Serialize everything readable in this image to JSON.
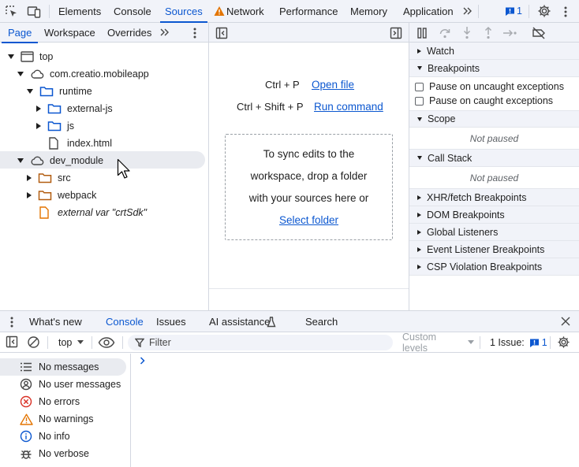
{
  "top_tabs": [
    {
      "label": "Elements"
    },
    {
      "label": "Console"
    },
    {
      "label": "Sources"
    },
    {
      "label": "Network"
    },
    {
      "label": "Performance"
    },
    {
      "label": "Memory"
    },
    {
      "label": "Application"
    }
  ],
  "issues_badge": "1",
  "navigator": {
    "tabs": [
      "Page",
      "Workspace",
      "Overrides"
    ],
    "tree": [
      {
        "label": "top"
      },
      {
        "label": "com.creatio.mobileapp"
      },
      {
        "label": "runtime"
      },
      {
        "label": "external-js"
      },
      {
        "label": "js"
      },
      {
        "label": "index.html"
      },
      {
        "label": "dev_module"
      },
      {
        "label": "src"
      },
      {
        "label": "webpack"
      },
      {
        "label": "external var \"crtSdk\""
      }
    ]
  },
  "editor": {
    "open_file_shortcut": "Ctrl + P",
    "open_file_label": "Open file",
    "run_command_shortcut": "Ctrl + Shift + P",
    "run_command_label": "Run command",
    "drop_text_1": "To sync edits to the",
    "drop_text_2": "workspace, drop a folder",
    "drop_text_3": "with your sources here or",
    "select_folder_label": "Select folder"
  },
  "debugger": {
    "watch": "Watch",
    "breakpoints": "Breakpoints",
    "pause_uncaught": "Pause on uncaught exceptions",
    "pause_caught": "Pause on caught exceptions",
    "scope": "Scope",
    "scope_status": "Not paused",
    "call_stack": "Call Stack",
    "call_stack_status": "Not paused",
    "xhr": "XHR/fetch Breakpoints",
    "dom": "DOM Breakpoints",
    "global": "Global Listeners",
    "event": "Event Listener Breakpoints",
    "csp": "CSP Violation Breakpoints"
  },
  "drawer": {
    "tabs": [
      "What's new",
      "Console",
      "Issues",
      "AI assistance",
      "Search"
    ],
    "context": "top",
    "filter_placeholder": "Filter",
    "levels": "Custom levels",
    "issues_label": "1 Issue:",
    "issues_count": "1",
    "sidebar": [
      {
        "label": "No messages"
      },
      {
        "label": "No user messages"
      },
      {
        "label": "No errors"
      },
      {
        "label": "No warnings"
      },
      {
        "label": "No info"
      },
      {
        "label": "No verbose"
      }
    ]
  },
  "colors": {
    "accent": "#0b57d0",
    "toolbar_bg": "#f1f3f9",
    "warning": "#e37400",
    "error": "#d93025",
    "folder": "#0b57d0",
    "file_orange": "#e37400"
  }
}
